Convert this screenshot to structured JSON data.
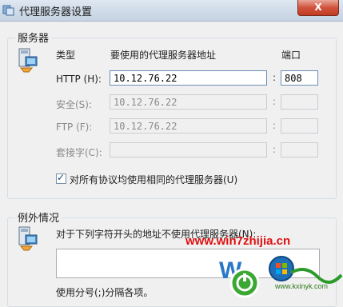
{
  "window": {
    "title": "代理服务器设置",
    "close_label": "X"
  },
  "servers": {
    "group_label": "服务器",
    "col_type": "类型",
    "col_address": "要使用的代理服务器地址",
    "col_port": "端口",
    "rows": [
      {
        "label": "HTTP (H):",
        "address": "10.12.76.22",
        "port": "808"
      },
      {
        "label": "安全(S):",
        "address": "10.12.76.22",
        "port": ""
      },
      {
        "label": "FTP (F):",
        "address": "10.12.76.22",
        "port": ""
      },
      {
        "label": "套接字(C):",
        "address": "",
        "port": ""
      }
    ],
    "same_proxy_label": "对所有协议均使用相同的代理服务器(U)",
    "same_proxy_checked": true
  },
  "exceptions": {
    "group_label": "例外情况",
    "description": "对于下列字符开头的地址不使用代理服务器(N):",
    "value": "",
    "hint": "使用分号(;)分隔各项。"
  },
  "watermark": {
    "url": "www.win7zhijia.cn",
    "brand_text": "W",
    "site_label": "www.kxinyk.com"
  }
}
